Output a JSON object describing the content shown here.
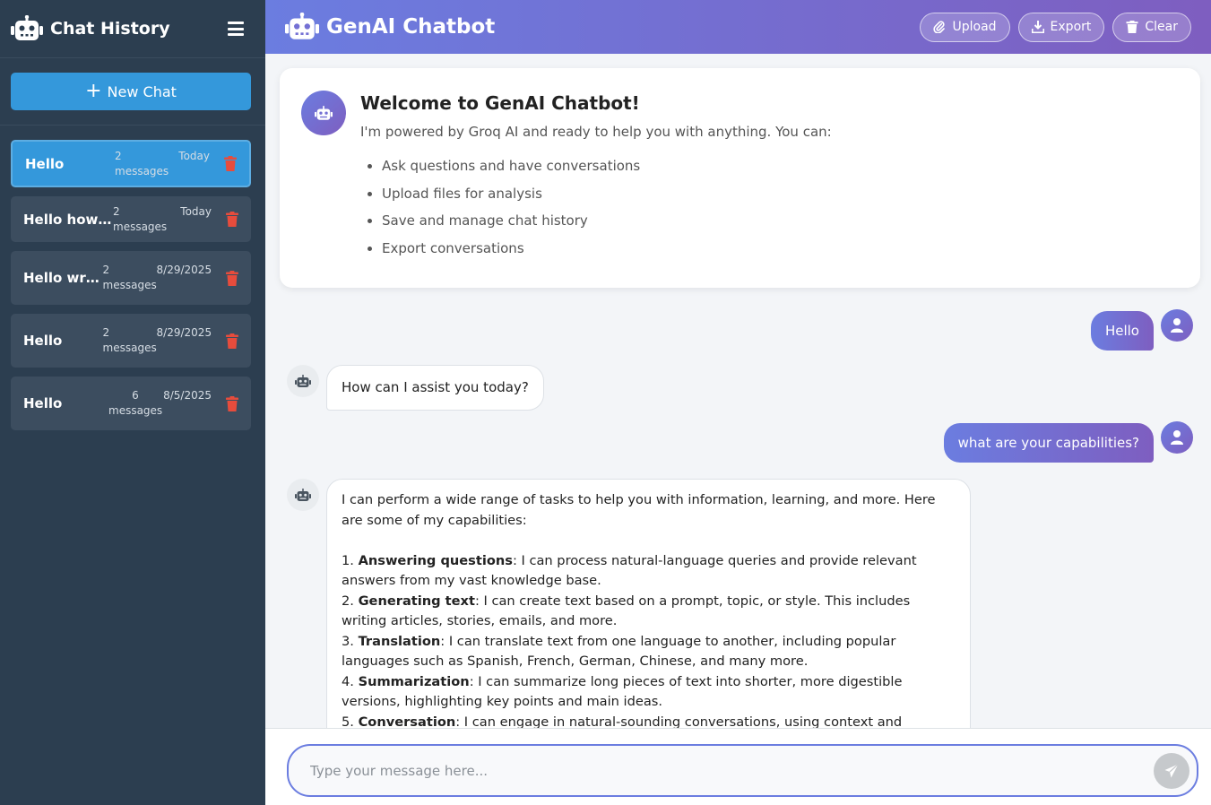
{
  "sidebar": {
    "title": "Chat History",
    "new_chat_label": "New Chat",
    "items": [
      {
        "title": "Hello",
        "count": "2 messages",
        "date": "Today",
        "active": true
      },
      {
        "title": "Hello how u...",
        "count": "2 messages",
        "date": "Today",
        "active": false
      },
      {
        "title": "Hello writ...",
        "count": "2 messages",
        "date": "8/29/2025",
        "active": false
      },
      {
        "title": "Hello",
        "count": "2 messages",
        "date": "8/29/2025",
        "active": false
      },
      {
        "title": "Hello",
        "count": "6 messages",
        "date": "8/5/2025",
        "active": false
      }
    ]
  },
  "header": {
    "title": "GenAI Chatbot",
    "buttons": {
      "upload": "Upload",
      "export": "Export",
      "clear": "Clear"
    }
  },
  "welcome": {
    "title": "Welcome to GenAI Chatbot!",
    "subtitle": "I'm powered by Groq AI and ready to help you with anything. You can:",
    "items": [
      "Ask questions and have conversations",
      "Upload files for analysis",
      "Save and manage chat history",
      "Export conversations"
    ]
  },
  "messages": {
    "user1": "Hello",
    "bot1": "How can I assist you today?",
    "user2": "what are your capabilities?",
    "bot2": {
      "intro": "I can perform a wide range of tasks to help you with information, learning, and more. Here are some of my capabilities:",
      "points": [
        {
          "num": "1.",
          "bold": "Answering questions",
          "text": ": I can process natural-language queries and provide relevant answers from my vast knowledge base."
        },
        {
          "num": "2.",
          "bold": "Generating text",
          "text": ": I can create text based on a prompt, topic, or style. This includes writing articles, stories, emails, and more."
        },
        {
          "num": "3.",
          "bold": "Translation",
          "text": ": I can translate text from one language to another, including popular languages such as Spanish, French, German, Chinese, and many more."
        },
        {
          "num": "4.",
          "bold": "Summarization",
          "text": ": I can summarize long pieces of text into shorter, more digestible versions, highlighting key points and main ideas."
        },
        {
          "num": "5.",
          "bold": "Conversation",
          "text": ": I can engage in natural-sounding conversations, using context and"
        }
      ]
    }
  },
  "input": {
    "placeholder": "Type your message here..."
  },
  "colors": {
    "sidebar_bg": "#2c3e50",
    "accent_blue": "#3498db",
    "gradient_start": "#6b7de0",
    "gradient_end": "#7e5ec0",
    "trash_red": "#e74c3c"
  }
}
